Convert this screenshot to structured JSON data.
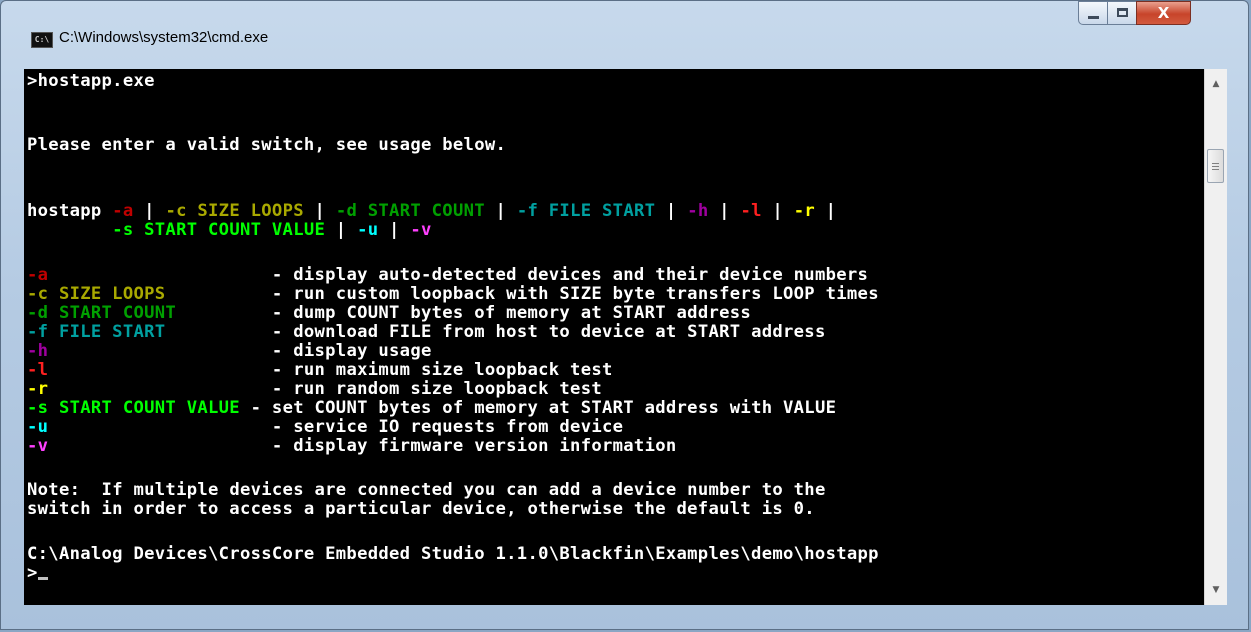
{
  "window": {
    "title": "C:\\Windows\\system32\\cmd.exe",
    "icon_text": "C:\\",
    "close_glyph": "X"
  },
  "console": {
    "prompt_command": ">hostapp.exe",
    "error_message": "Please enter a valid switch, see usage below.",
    "usage_line1": {
      "program": "hostapp ",
      "sep": " | ",
      "a": "-a",
      "c": "-c SIZE LOOPS",
      "d": "-d START COUNT",
      "f": "-f FILE START",
      "h": "-h",
      "l": "-l",
      "r": "-r",
      "trail": " |"
    },
    "usage_line2": {
      "indent": "        ",
      "s": "-s START COUNT VALUE",
      "sep": " | ",
      "u": "-u",
      "v": "-v"
    },
    "options": [
      {
        "switch": "-a",
        "args": "",
        "pad": "                     ",
        "desc": "- display auto-detected devices and their device numbers"
      },
      {
        "switch": "-c",
        "args": " SIZE LOOPS",
        "pad": "          ",
        "desc": "- run custom loopback with SIZE byte transfers LOOP times"
      },
      {
        "switch": "-d",
        "args": " START COUNT",
        "pad": "         ",
        "desc": "- dump COUNT bytes of memory at START address"
      },
      {
        "switch": "-f",
        "args": " FILE START",
        "pad": "          ",
        "desc": "- download FILE from host to device at START address"
      },
      {
        "switch": "-h",
        "args": "",
        "pad": "                     ",
        "desc": "- display usage"
      },
      {
        "switch": "-l",
        "args": "",
        "pad": "                     ",
        "desc": "- run maximum size loopback test"
      },
      {
        "switch": "-r",
        "args": "",
        "pad": "                     ",
        "desc": "- run random size loopback test"
      },
      {
        "switch": "-s",
        "args": " START COUNT VALUE",
        "pad": " ",
        "desc": "- set COUNT bytes of memory at START address with VALUE"
      },
      {
        "switch": "-u",
        "args": "",
        "pad": "                     ",
        "desc": "- service IO requests from device"
      },
      {
        "switch": "-v",
        "args": "",
        "pad": "                     ",
        "desc": "- display firmware version information"
      }
    ],
    "note_label": "Note:",
    "note_line1": "  If multiple devices are connected you can add a device number to the",
    "note_line2": "switch in order to access a particular device, otherwise the default is 0.",
    "cwd_line": "C:\\Analog Devices\\CrossCore Embedded Studio 1.1.0\\Blackfin\\Examples\\demo\\hostapp",
    "prompt_char": ">"
  },
  "colors": {
    "console_bg": "#000000",
    "console_text": "#c0c0c0",
    "titlebar": "#b5cbe3",
    "close_button": "#c7442a"
  },
  "icons": {
    "app": "cmd-icon",
    "minimize": "minimize-icon",
    "maximize": "maximize-icon",
    "close": "close-icon",
    "scroll_up": "chevron-up-icon",
    "scroll_down": "chevron-down-icon"
  }
}
